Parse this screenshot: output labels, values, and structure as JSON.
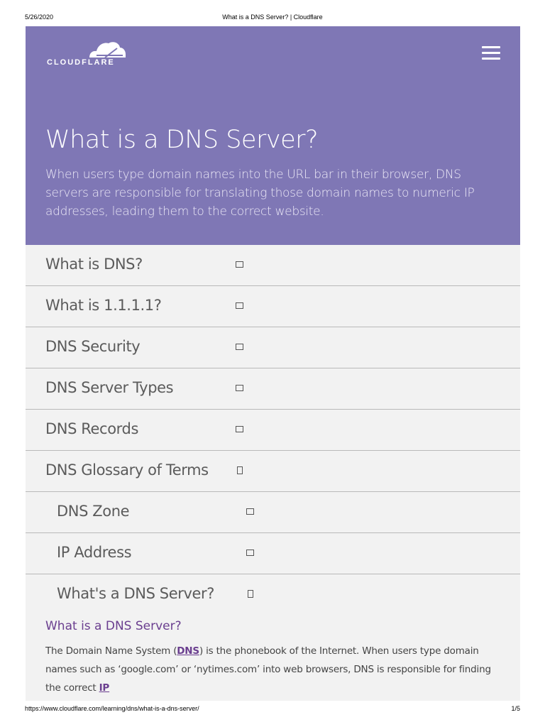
{
  "print_header": {
    "date": "5/26/2020",
    "title": "What is a DNS Server? | Cloudflare"
  },
  "brand": {
    "name": "CLOUDFLARE",
    "hero_color": "#7f77b5",
    "accent_link_color": "#6a3e8f"
  },
  "header": {
    "menu_icon": "hamburger-menu-icon"
  },
  "hero": {
    "title": "What is a DNS Server?",
    "lead": "When users type domain names into the URL bar in their browser, DNS servers are responsible for translating those domain names to numeric IP addresses, leading them to the correct website."
  },
  "nav": {
    "items": [
      {
        "label": "What is DNS?"
      },
      {
        "label": "What is 1.1.1.1?"
      },
      {
        "label": "DNS Security"
      },
      {
        "label": "DNS Server Types"
      },
      {
        "label": "DNS Records"
      },
      {
        "label": "DNS Glossary of Terms"
      },
      {
        "label": "DNS Zone"
      },
      {
        "label": "IP Address"
      },
      {
        "label": "What's a DNS Server?"
      }
    ]
  },
  "article": {
    "heading": "What is a DNS Server?",
    "p1_a": "The Domain Name System (",
    "p1_link_dns": "DNS",
    "p1_b": ") is the phonebook of the Internet. When users type domain names such as ‘google.com’ or ‘nytimes.com’ into web browsers, DNS is responsible for finding the correct ",
    "p1_link_ip": "IP"
  },
  "print_footer": {
    "url": "https://www.cloudflare.com/learning/dns/what-is-a-dns-server/",
    "page": "1/5"
  }
}
